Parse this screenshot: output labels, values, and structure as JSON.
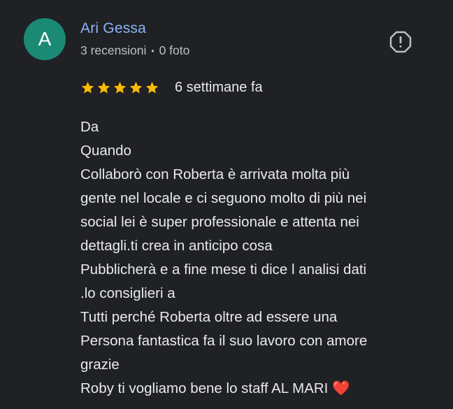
{
  "review": {
    "author": {
      "initial": "A",
      "name": "Ari Gessa",
      "reviews_count": "3 recensioni",
      "separator": "•",
      "photos_count": "0 foto",
      "avatar_color": "#1b8a75"
    },
    "flag_icon": "report-flag-icon",
    "rating": 5,
    "rating_max": 5,
    "star_color": "#fbbc04",
    "date": "6 settimane fa",
    "text_lines": [
      "Da",
      "Quando",
      "Collaborò con Roberta è arrivata molta più",
      "gente nel locale e ci seguono molto di più nei",
      "social lei è super professionale e attenta nei",
      "dettagli.ti crea in anticipo cosa",
      "Pubblicherà e a fine mese ti dice l analisi dati",
      ".lo consiglieri a",
      "Tutti perché Roberta oltre ad essere una",
      "Persona fantastica fa il suo lavoro con amore",
      "grazie",
      "Roby ti vogliamo bene lo staff AL MARI ❤️"
    ]
  }
}
